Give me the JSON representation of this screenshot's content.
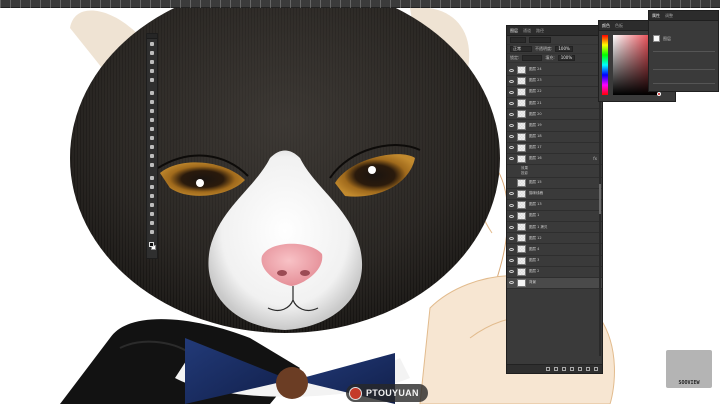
{
  "ruler": {},
  "toolbar": {
    "tools": [
      "move-tool",
      "marquee-tool",
      "lasso-tool",
      "quick-select-tool",
      "crop-tool",
      "eyedropper-tool",
      "healing-tool",
      "brush-tool",
      "clone-stamp-tool",
      "history-brush-tool",
      "eraser-tool",
      "gradient-tool",
      "blur-tool",
      "dodge-tool",
      "pen-tool",
      "type-tool",
      "path-select-tool",
      "shape-tool",
      "hand-tool",
      "zoom-tool",
      "more-tools"
    ],
    "colors": {
      "foreground": "#111111",
      "background": "#ffffff"
    }
  },
  "layers_panel": {
    "tabs": [
      "图层",
      "通道",
      "路径"
    ],
    "blend_mode": "正常",
    "opacity_label": "不透明度:",
    "opacity_value": "100%",
    "lock_label": "锁定:",
    "fill_label": "填充:",
    "fill_value": "100%",
    "layers": [
      {
        "name": "图层 24",
        "visible": true
      },
      {
        "name": "图层 23",
        "visible": true
      },
      {
        "name": "图层 22",
        "visible": true
      },
      {
        "name": "图层 21",
        "visible": true
      },
      {
        "name": "图层 20",
        "visible": true
      },
      {
        "name": "图层 19",
        "visible": true
      },
      {
        "name": "图层 18",
        "visible": true
      },
      {
        "name": "图层 17",
        "visible": true
      },
      {
        "name": "图层 16",
        "visible": true,
        "fx": "fx"
      }
    ],
    "group": {
      "line1": "效果",
      "line2": "投影"
    },
    "layers_bottom": [
      {
        "name": "图层 15",
        "visible": false
      },
      {
        "name": "猫咪线稿",
        "visible": true
      },
      {
        "name": "图层 13",
        "visible": true
      },
      {
        "name": "图层 1",
        "visible": true
      },
      {
        "name": "图层 1 拷贝",
        "visible": true
      },
      {
        "name": "图层 12",
        "visible": true
      },
      {
        "name": "图层 4",
        "visible": true
      },
      {
        "name": "图层 3",
        "visible": true
      },
      {
        "name": "图层 2",
        "visible": true
      },
      {
        "name": "背景",
        "visible": true,
        "selected": true
      }
    ]
  },
  "color_panel": {
    "tabs": [
      "颜色",
      "色板"
    ]
  },
  "props_panel": {
    "tabs": [
      "属性",
      "调整"
    ],
    "title": "图层"
  },
  "watermark": {
    "text": "PTOUYUAN"
  },
  "corner": {
    "code": "SOOVIEW"
  }
}
